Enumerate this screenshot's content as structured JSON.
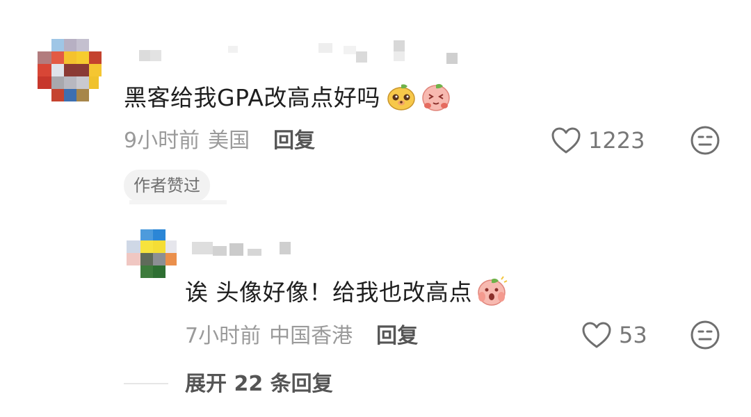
{
  "comments": [
    {
      "text": "黑客给我GPA改高点好吗",
      "time": "9小时前",
      "location": "美国",
      "reply_label": "回复",
      "likes": "1223",
      "badge": "作者赞过",
      "emojis": [
        "doge-sticker-icon",
        "pleading-peach-sticker-icon"
      ]
    },
    {
      "text": "诶 头像好像！给我也改高点",
      "time": "7小时前",
      "location": "中国香港",
      "reply_label": "回复",
      "likes": "53",
      "emojis": [
        "screaming-peach-sticker-icon"
      ]
    }
  ],
  "expand_label": "展开 22 条回复",
  "colors": {
    "text": "#1e1e1e",
    "meta": "#9a9a9a",
    "badge_bg": "#f2f2f2"
  }
}
